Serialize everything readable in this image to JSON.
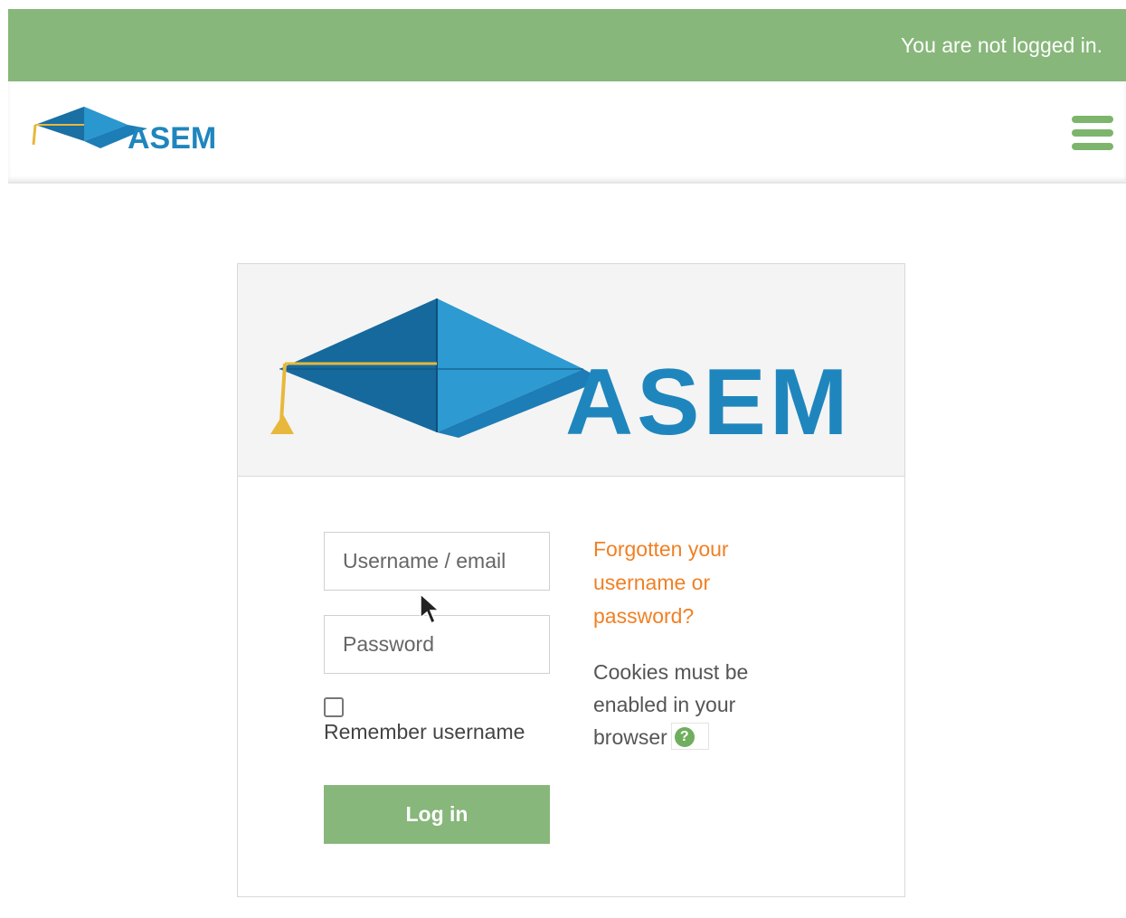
{
  "topbar": {
    "status_text": "You are not logged in."
  },
  "navbar": {
    "logo_name": "ASEM",
    "menu_icon": "hamburger-menu-icon"
  },
  "login": {
    "logo_name": "ASEM",
    "username_placeholder": "Username / email",
    "password_placeholder": "Password",
    "remember_label": "Remember username",
    "remember_checked": false,
    "login_button": "Log in",
    "forgot_link": "Forgotten your username or password?",
    "cookies_text": "Cookies must be enabled in your browser",
    "help_icon": "question-circle-icon"
  },
  "colors": {
    "topbar": "#87b77a",
    "button": "#87b77a",
    "link": "#f08024",
    "logo_blue": "#1f86bd",
    "logo_gold": "#e8b83c"
  }
}
